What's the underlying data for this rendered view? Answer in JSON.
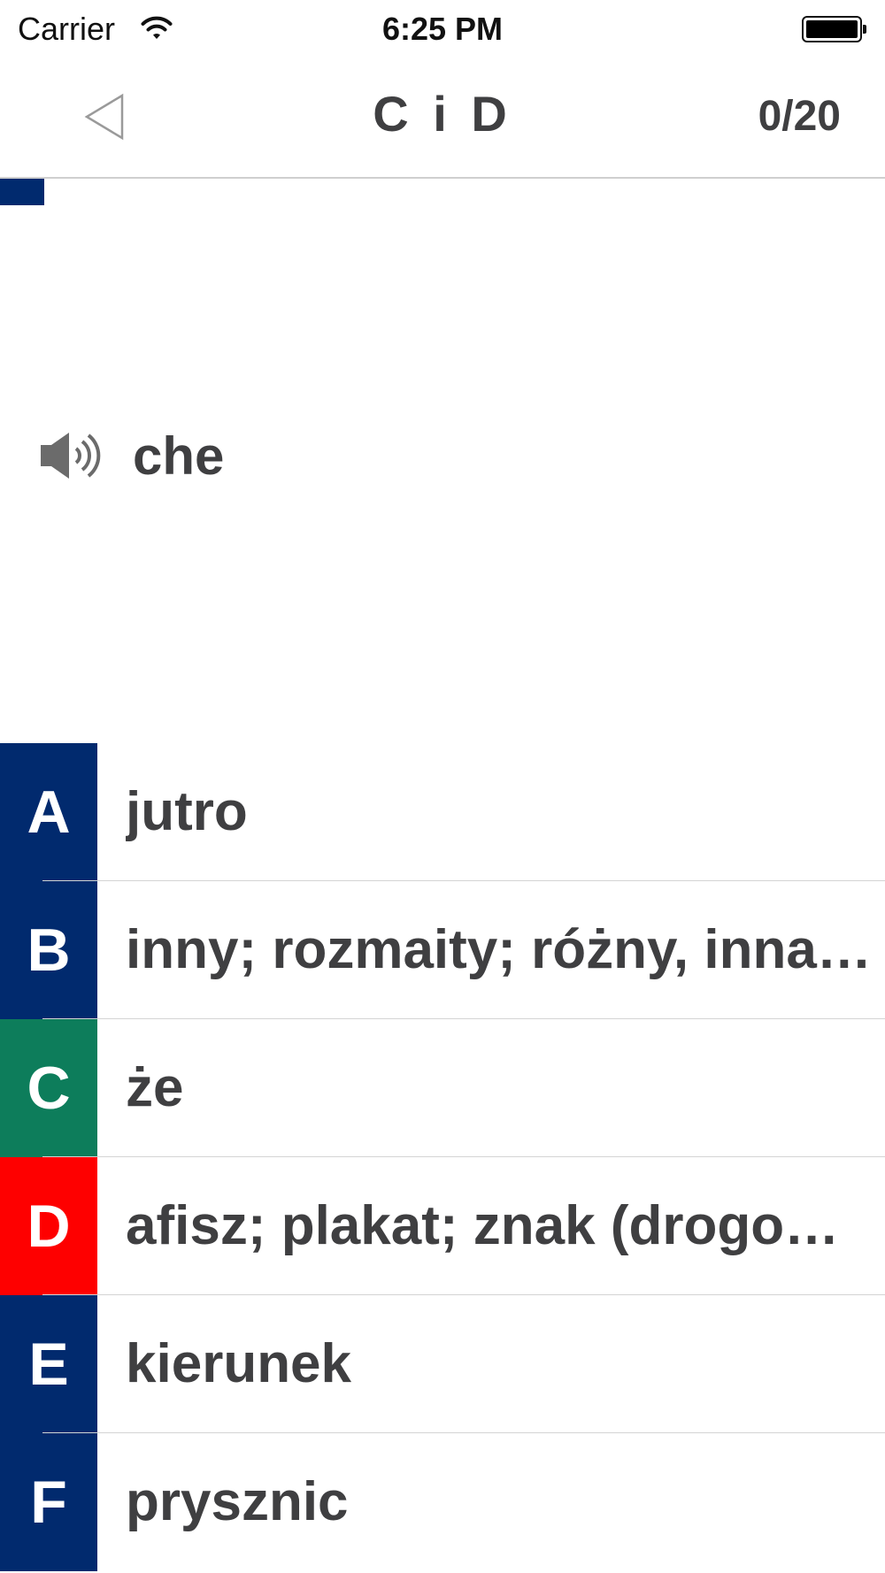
{
  "status_bar": {
    "carrier": "Carrier",
    "time": "6:25 PM",
    "battery_level": 1.0
  },
  "nav": {
    "back_icon": "back-triangle-icon",
    "title": "C i D",
    "counter": "0/20"
  },
  "progress": {
    "fraction": 0.05,
    "color": "#012a6e"
  },
  "question": {
    "icon": "speaker-icon",
    "word": "che"
  },
  "answers": [
    {
      "letter": "A",
      "text": "jutro",
      "color": "#012a6e",
      "state": "default"
    },
    {
      "letter": "B",
      "text": "inny; rozmaity; różny, inna; różna; inne; różne",
      "color": "#012a6e",
      "state": "default"
    },
    {
      "letter": "C",
      "text": "że",
      "color": "#0d7d5b",
      "state": "correct"
    },
    {
      "letter": "D",
      "text": "afisz; plakat; znak (drogowy)",
      "color": "#fe0000",
      "state": "wrong"
    },
    {
      "letter": "E",
      "text": "kierunek",
      "color": "#012a6e",
      "state": "default"
    },
    {
      "letter": "F",
      "text": "prysznic",
      "color": "#012a6e",
      "state": "default"
    }
  ]
}
